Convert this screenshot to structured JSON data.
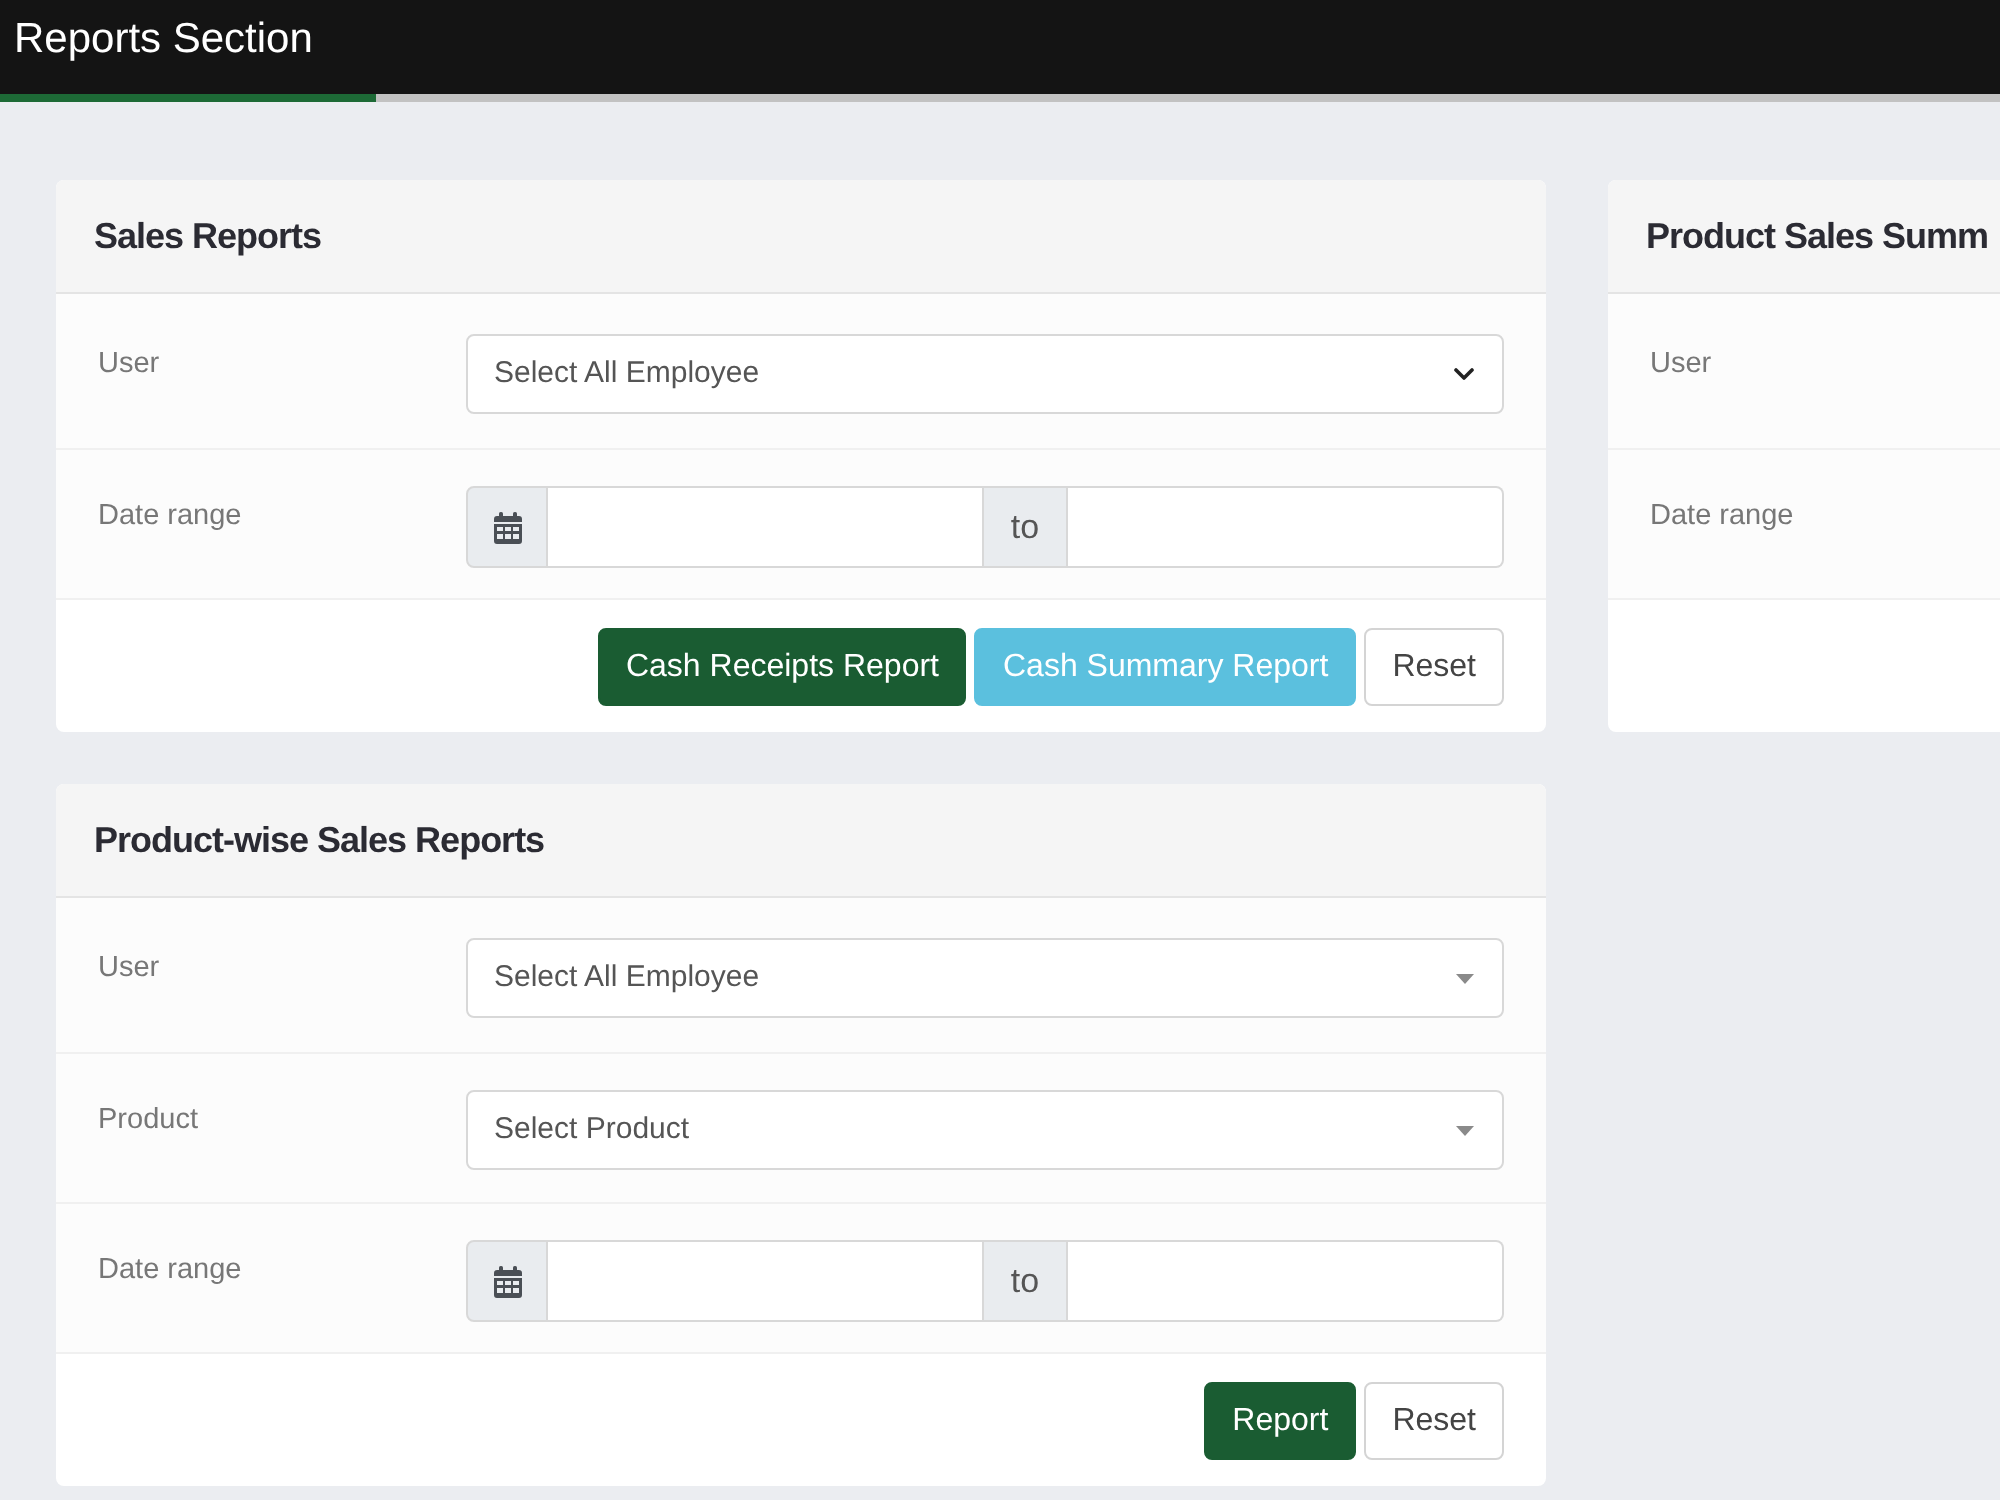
{
  "top_bar": {
    "title": "Reports Section"
  },
  "loading_bar": {
    "level": 0.188
  },
  "columns": [
    {
      "panels": [
        {
          "title": "Sales Reports",
          "fields": [
            {
              "kind": "select",
              "label": "User",
              "value": "Select All Employee"
            },
            {
              "kind": "date-range",
              "label": "Date range",
              "separator": "to"
            }
          ],
          "buttons": [
            {
              "kind": "primary",
              "label": "Cash Receipts Report"
            },
            {
              "kind": "info",
              "label": "Cash Summary Report"
            },
            {
              "kind": "default",
              "label": "Reset"
            }
          ]
        },
        {
          "title": "Product-wise Sales Reports",
          "fields": [
            {
              "kind": "searchable-select",
              "label": "User",
              "value": "Select All Employee"
            },
            {
              "kind": "searchable-select",
              "label": "Product",
              "value": "Select Product"
            },
            {
              "kind": "date-range",
              "label": "Date range",
              "separator": "to"
            }
          ],
          "buttons": [
            {
              "kind": "primary",
              "label": "Report"
            },
            {
              "kind": "default",
              "label": "Reset"
            }
          ]
        }
      ]
    },
    {
      "panels": [
        {
          "title": "Product Sales Summ",
          "fields": [
            {
              "label": "User"
            },
            {
              "label": "Date range"
            }
          ]
        }
      ]
    }
  ]
}
